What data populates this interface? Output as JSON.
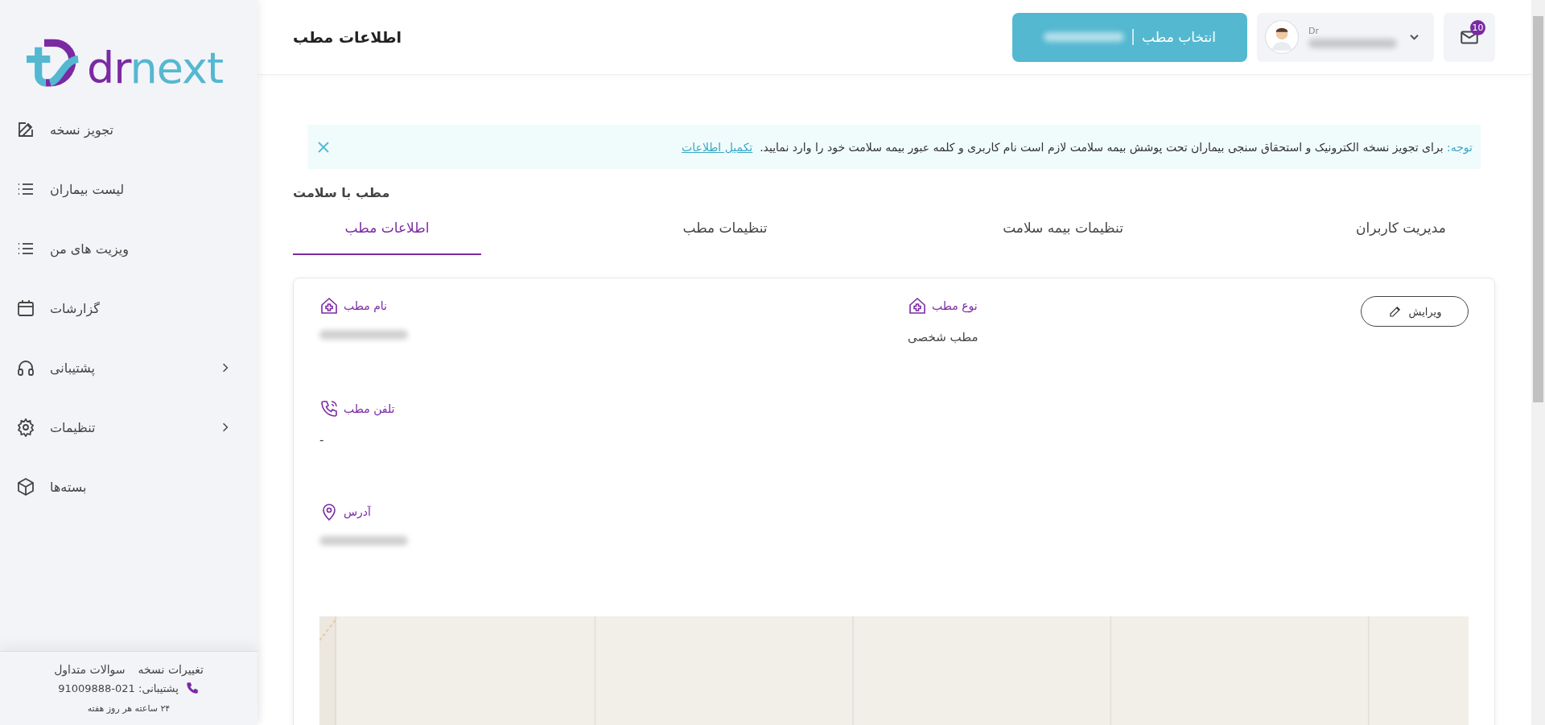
{
  "sidebar": {
    "logo": {
      "first": "dr",
      "second": "next"
    },
    "items": [
      {
        "label": "تجویز نسخه",
        "has_submenu": false
      },
      {
        "label": "لیست بیماران",
        "has_submenu": false
      },
      {
        "label": "ویزیت های من",
        "has_submenu": false
      },
      {
        "label": "گزارشات",
        "has_submenu": false
      },
      {
        "label": "پشتیبانی",
        "has_submenu": true
      },
      {
        "label": "تنظیمات",
        "has_submenu": true
      },
      {
        "label": "بسته‌ها",
        "has_submenu": false
      }
    ],
    "footer": {
      "links": [
        "تغییرات نسخه",
        "سوالات متداول"
      ],
      "support": "پشتیبانی: 021-91009888",
      "hours": "۲۴ ساعته هر روز هفته"
    }
  },
  "header": {
    "title": "اطلاعات مطب",
    "clinic_button": "انتخاب مطب",
    "user_prefix": "Dr",
    "mail_badge": "10"
  },
  "alert": {
    "label": "توجه:",
    "text": "برای تجویز نسخه الکترونیک و استحقاق سنجی بیماران تحت پوشش بیمه سلامت لازم است نام کاربری و کلمه عبور بیمه سلامت خود را وارد نمایید.",
    "link": "تکمیل اطلاعات"
  },
  "clinic_heading": "مطب با سلامت",
  "tabs": [
    {
      "label": "مدیریت کاربران",
      "selected": false
    },
    {
      "label": "تنظیمات بیمه سلامت",
      "selected": false
    },
    {
      "label": "تنظیمات مطب",
      "selected": false
    },
    {
      "label": "اطلاعات مطب",
      "selected": true
    }
  ],
  "card": {
    "edit_button": "ویرایش",
    "fields": [
      {
        "label": "نام مطب"
      },
      {
        "label": "نوع مطب",
        "value": "مطب شخصی"
      },
      {
        "label": "تلفن مطب",
        "value": "-"
      },
      {
        "label": "آدرس"
      }
    ]
  }
}
